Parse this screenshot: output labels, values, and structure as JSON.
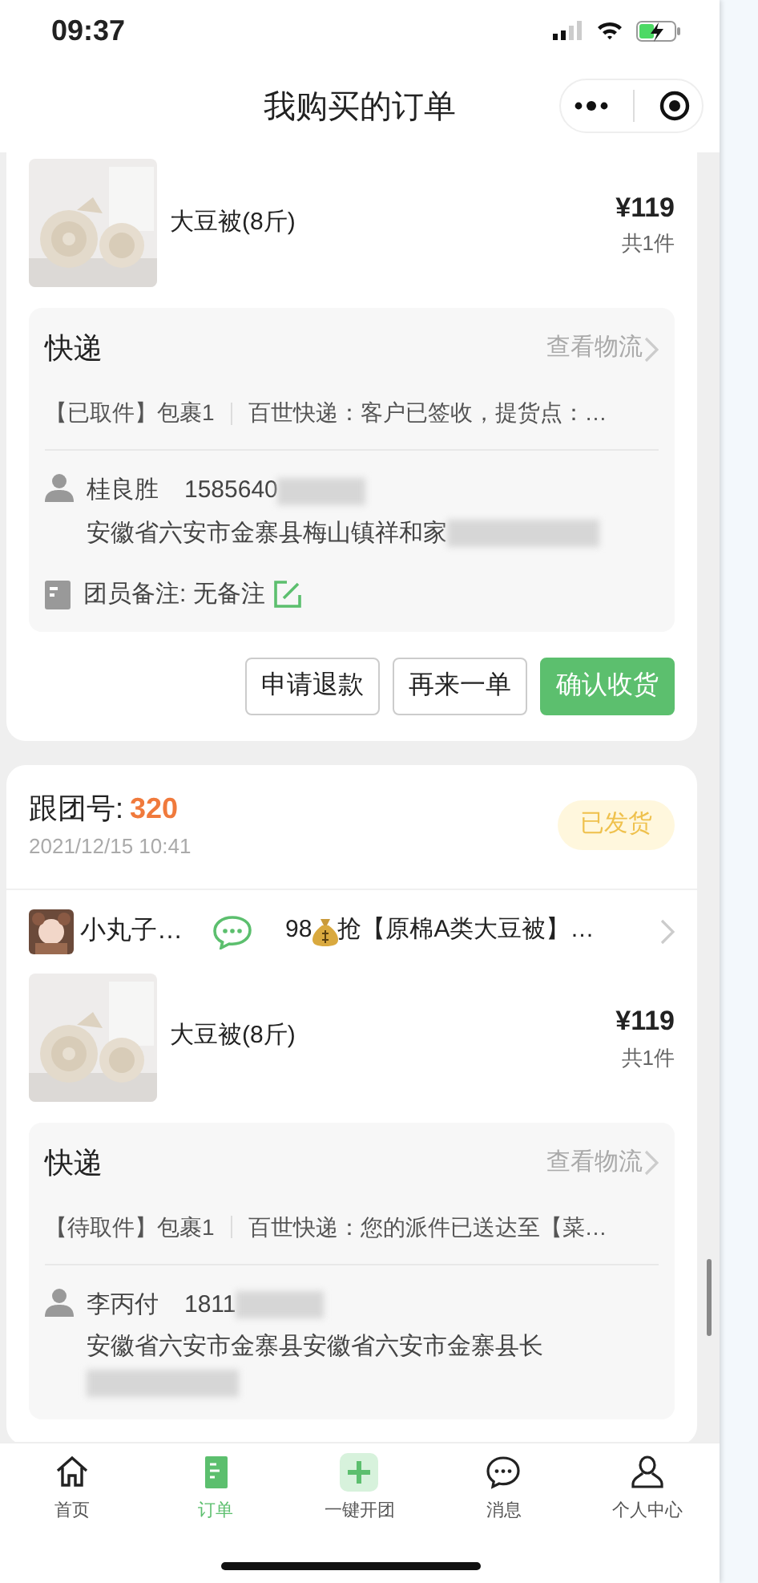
{
  "status_bar": {
    "time": "09:37"
  },
  "nav": {
    "title": "我购买的订单"
  },
  "orders": [
    {
      "product": {
        "name": "大豆被(8斤)",
        "price": "¥119",
        "quantity": "共1件"
      },
      "shipping": {
        "title": "快递",
        "link": "查看物流",
        "status": "【已取件】包裹1",
        "message": "百世快递：客户已签收，提货点：…",
        "contact_name": "桂良胜",
        "phone": "1585640",
        "address": "安徽省六安市金寨县梅山镇祥和家",
        "redacted": true,
        "note": "团员备注: 无备注"
      },
      "buttons": [
        {
          "label": "申请退款",
          "kind": "outline"
        },
        {
          "label": "再来一单",
          "kind": "outline"
        },
        {
          "label": "确认收货",
          "kind": "primary"
        }
      ]
    },
    {
      "header": {
        "label": "跟团号:",
        "number": "320",
        "date": "2021/12/15 10:41",
        "status": "已发货"
      },
      "leader": {
        "name": "小丸子…",
        "price": "98",
        "post": "抢【原棉A类大豆被】…"
      },
      "product": {
        "name": "大豆被(8斤)",
        "price": "¥119",
        "quantity": "共1件"
      },
      "shipping": {
        "title": "快递",
        "link": "查看物流",
        "status": "【待取件】包裹1",
        "message": "百世快递：您的派件已送达至【菜…",
        "contact_name": "李丙付",
        "phone": "1811",
        "address": "安徽省六安市金寨县安徽省六安市金寨县长",
        "redacted": true
      }
    }
  ],
  "tab_bar": [
    {
      "label": "首页",
      "selected": false
    },
    {
      "label": "订单",
      "selected": true
    },
    {
      "label": "一键开团",
      "selected": false
    },
    {
      "label": "消息",
      "selected": false
    },
    {
      "label": "个人中心",
      "selected": false
    }
  ]
}
